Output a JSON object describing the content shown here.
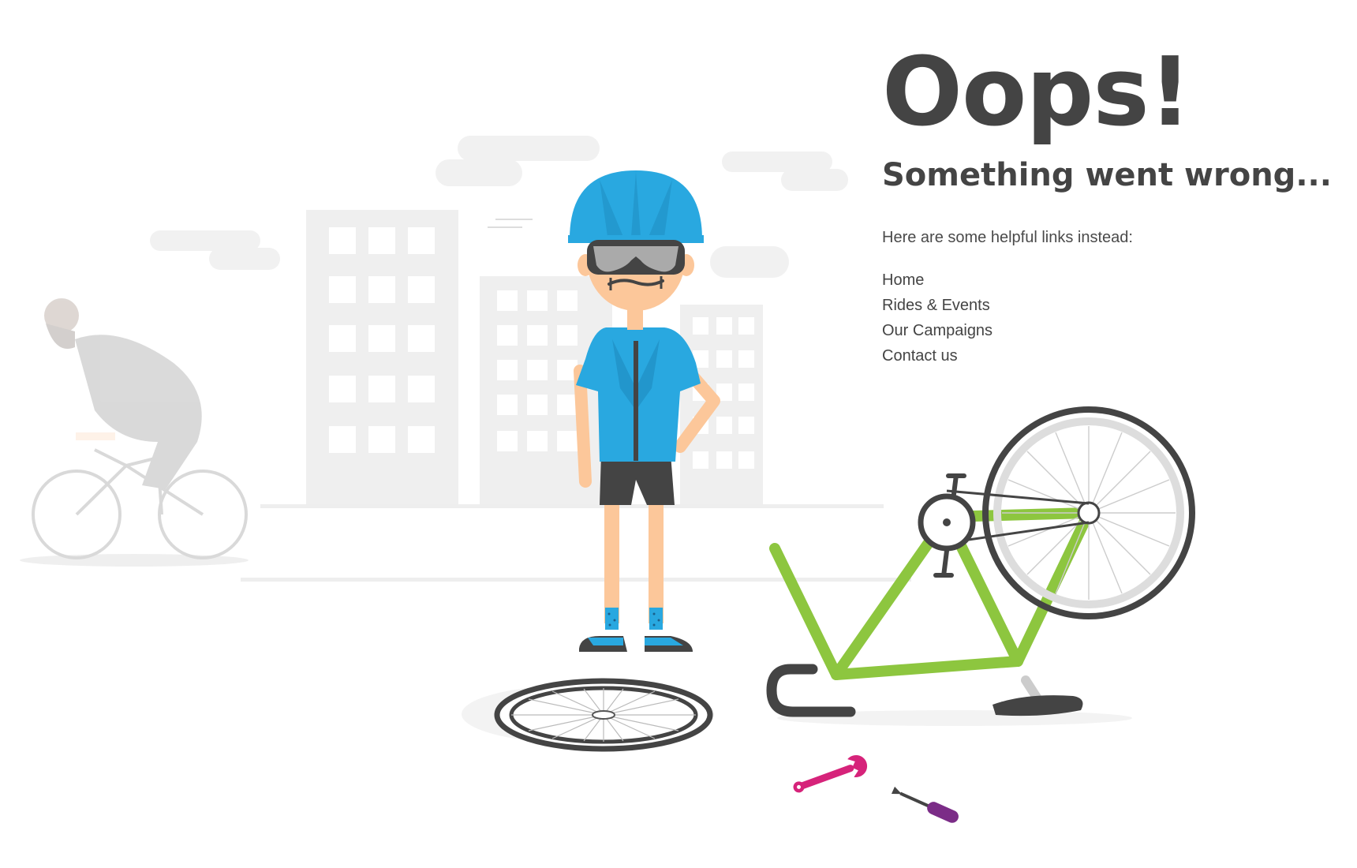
{
  "error": {
    "heading": "Oops!",
    "subheading": "Something went wrong...",
    "intro": "Here are some helpful links instead:"
  },
  "links": [
    {
      "label": "Home"
    },
    {
      "label": "Rides & Events"
    },
    {
      "label": "Our Campaigns"
    },
    {
      "label": "Contact us"
    }
  ],
  "colors": {
    "text": "#444444",
    "helmet": "#29a8e0",
    "jersey": "#29a8e0",
    "bike_frame": "#8dc63f",
    "wrench": "#d6237a",
    "screwdriver": "#7b2c87",
    "skin": "#fcc79a",
    "city": "#eeeeee"
  },
  "icons": [
    "broken-bike-illustration",
    "cyclist-figure",
    "wrench-icon",
    "screwdriver-icon",
    "wheel-icon"
  ]
}
